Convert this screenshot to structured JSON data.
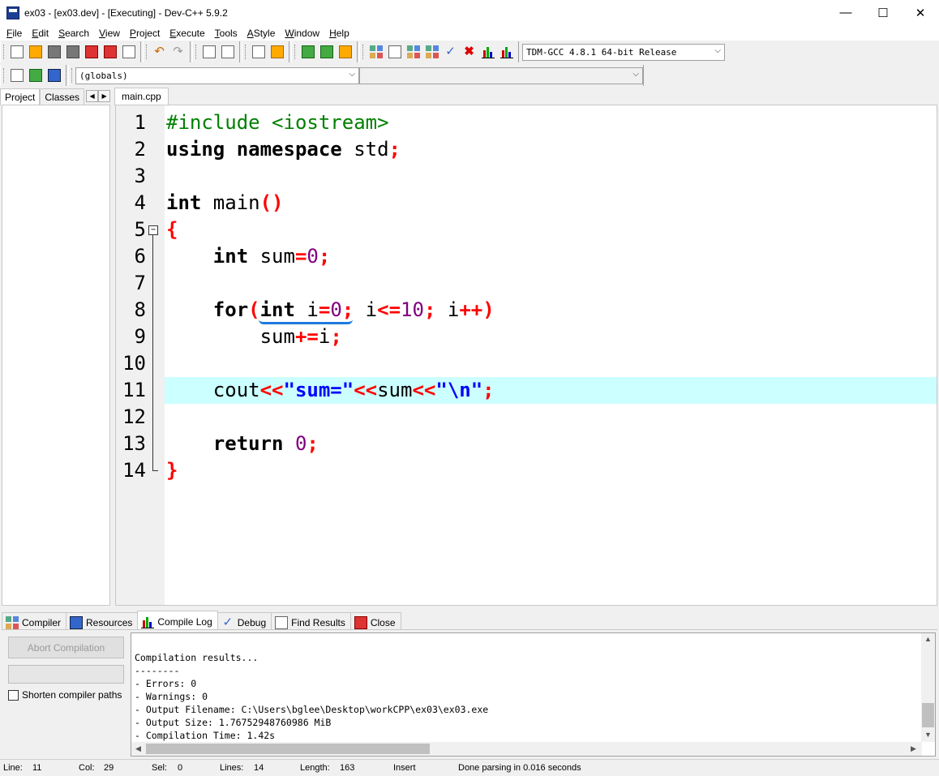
{
  "window": {
    "title": "ex03 - [ex03.dev] - [Executing] - Dev-C++ 5.9.2",
    "minimize": "—",
    "maximize": "☐",
    "close": "✕"
  },
  "menu": [
    {
      "label": "File",
      "accel": "F",
      "rest": "ile"
    },
    {
      "label": "Edit",
      "accel": "E",
      "rest": "dit"
    },
    {
      "label": "Search",
      "accel": "S",
      "rest": "earch"
    },
    {
      "label": "View",
      "accel": "V",
      "rest": "iew"
    },
    {
      "label": "Project",
      "accel": "P",
      "rest": "roject"
    },
    {
      "label": "Execute",
      "accel": "E",
      "rest": "xecute"
    },
    {
      "label": "Tools",
      "accel": "T",
      "rest": "ools"
    },
    {
      "label": "AStyle",
      "accel": "A",
      "rest": "Style"
    },
    {
      "label": "Window",
      "accel": "W",
      "rest": "indow"
    },
    {
      "label": "Help",
      "accel": "H",
      "rest": "elp"
    }
  ],
  "toolbar": {
    "compiler_select": "TDM-GCC 4.8.1 64-bit Release",
    "scope_select": "(globals)",
    "member_select": ""
  },
  "left_panel": {
    "tabs": [
      "Project",
      "Classes"
    ]
  },
  "editor": {
    "file_tab": "main.cpp",
    "line_numbers": [
      "1",
      "2",
      "3",
      "4",
      "5",
      "6",
      "7",
      "8",
      "9",
      "10",
      "11",
      "12",
      "13",
      "14"
    ],
    "highlighted_line": 11
  },
  "bottom_panel": {
    "tabs": [
      "Compiler",
      "Resources",
      "Compile Log",
      "Debug",
      "Find Results",
      "Close"
    ],
    "active_tab": "Compile Log",
    "abort_button": "Abort Compilation",
    "shorten_paths_label": "Shorten compiler paths",
    "log_lines": [
      "Compilation results...",
      "--------",
      "- Errors: 0",
      "- Warnings: 0",
      "- Output Filename: C:\\Users\\bglee\\Desktop\\workCPP\\ex03\\ex03.exe",
      "- Output Size: 1.76752948760986 MiB",
      "- Compilation Time: 1.42s"
    ]
  },
  "status": {
    "line_label": "Line:",
    "line": "11",
    "col_label": "Col:",
    "col": "29",
    "sel_label": "Sel:",
    "sel": "0",
    "lines_label": "Lines:",
    "lines": "14",
    "length_label": "Length:",
    "length": "163",
    "mode": "Insert",
    "message": "Done parsing in 0.016 seconds"
  }
}
